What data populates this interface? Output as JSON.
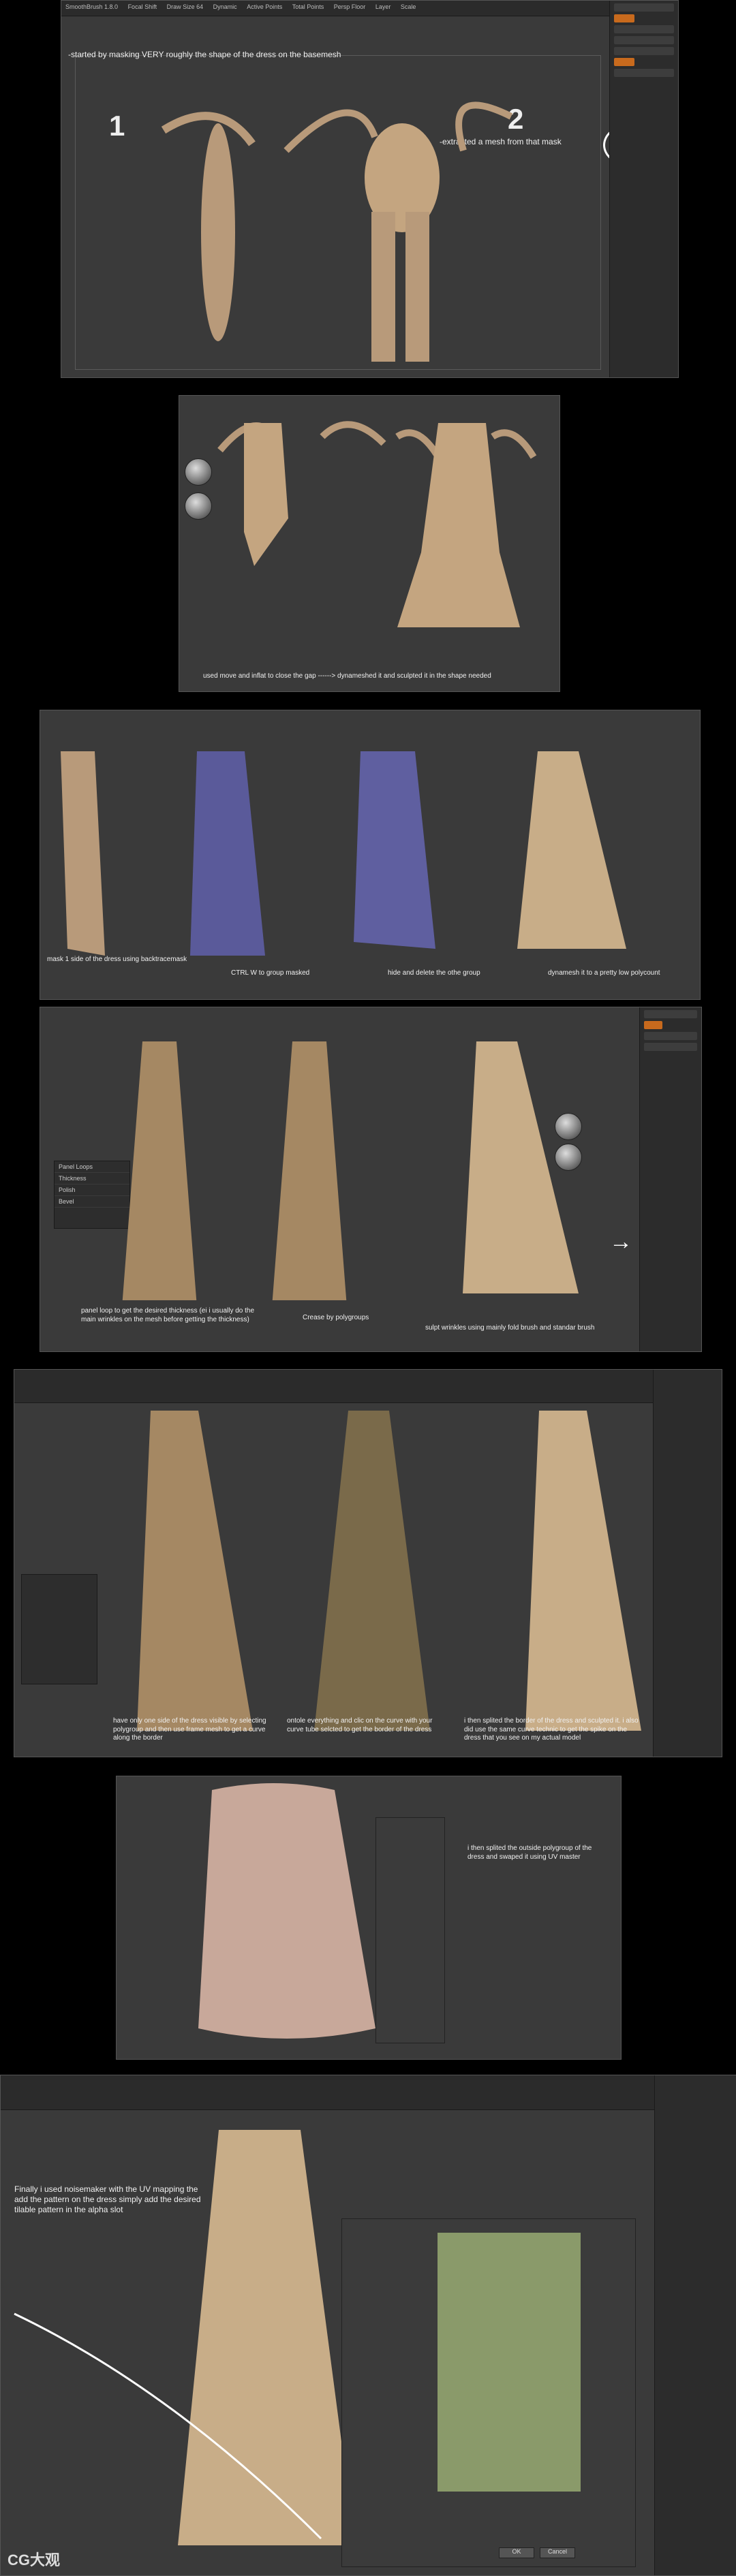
{
  "panels": {
    "p1": {
      "caption": "-started by masking VERY roughly the shape of the dress on the basemesh",
      "num_left": "1",
      "num_right": "2",
      "side_note": "-extracted a mesh from that mask",
      "topbar": [
        "SmoothBrush 1.8.0",
        "Focal Shift",
        "Draw Size 64",
        "Dynamic",
        "Active Points",
        "Total Points",
        "Persp Floor",
        "Layer",
        "Scale"
      ]
    },
    "p2": {
      "caption": "used move and inflat to close the gap ------> dynameshed it and sculpted it in the shape needed"
    },
    "p3": {
      "label1": "mask 1 side of the dress using backtracemask",
      "label2": "CTRL W to group masked",
      "label3": "hide and delete the othe group",
      "label4": "dynamesh it to a pretty low polycount"
    },
    "p4": {
      "label1": "panel loop to get the desired thickness (ei i usually do the main wrinkles on the mesh before getting the thickness)",
      "label2": "Crease by polygroups",
      "label3": "sulpt wrinkles using mainly fold brush and standar brush"
    },
    "p5": {
      "label1": "have only one side of the dress visible by selecting polygroup and then use frame mesh to get a curve along the border",
      "label2": "ontole everything and clic on the curve with your curve tube selcted to get the border of the dress",
      "label3": "i then splited the border of the dress and sculpted it. i also did use the same curve technic to get the spike on the dress that you see on my actual model"
    },
    "p6": {
      "label": "i then splited the outside polygroup of the dress and swaped it using UV master"
    },
    "p7": {
      "label": "Finally i used noisemaker with the UV mapping the add the pattern on the dress simply add the desired tilable pattern in the alpha slot",
      "dialog_ok": "OK",
      "dialog_cancel": "Cancel",
      "watermark": "CG大观"
    }
  }
}
